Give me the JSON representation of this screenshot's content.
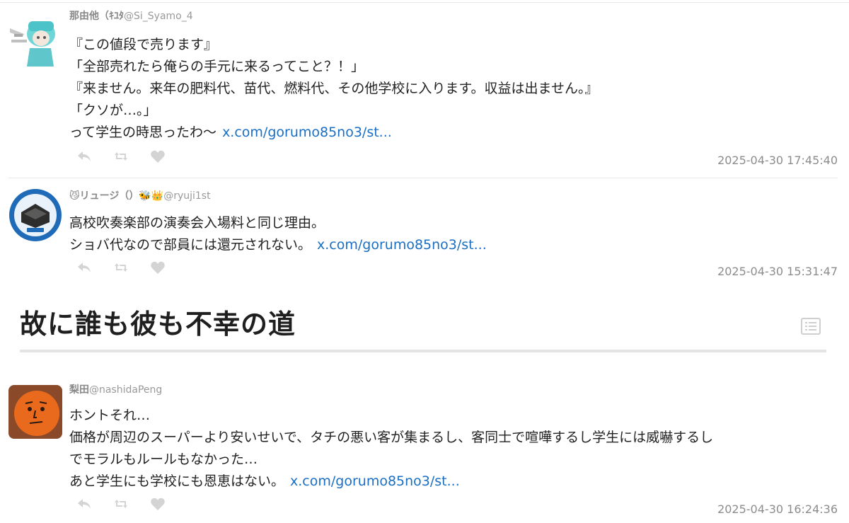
{
  "tweets": [
    {
      "name": "那由他（ｷﾕﾀ",
      "handle": "@Si_Syamo_4",
      "lines": [
        "『この値段で売ります』",
        "「全部売れたら俺らの手元に来るってこと？！」",
        "『来ません。来年の肥料代、苗代、燃料代、その他学校に入ります。収益は出ません。』",
        "「クソが…。」",
        "って学生の時思ったわ〜"
      ],
      "link": "x.com/gorumo85no3/st...",
      "timestamp": "2025-04-30 17:45:40"
    },
    {
      "name": "😼リュージ（）🐝👑",
      "handle": "@ryuji1st",
      "lines": [
        "高校吹奏楽部の演奏会入場料と同じ理由。",
        "ショバ代なので部員には還元されない。"
      ],
      "link": "x.com/gorumo85no3/st...",
      "timestamp": "2025-04-30 15:31:47"
    },
    {
      "name": "梨田",
      "handle": "@nashidaPeng",
      "lines": [
        "ホントそれ…",
        "価格が周辺のスーパーより安いせいで、タチの悪い客が集まるし、客同士で喧嘩するし学生には威嚇するし",
        "でモラルもルールもなかった…",
        "あと学生にも学校にも恩恵はない。"
      ],
      "link": "x.com/gorumo85no3/st...",
      "timestamp": "2025-04-30 16:24:36"
    }
  ],
  "section_heading": "故に誰も彼も不幸の道",
  "icons": {
    "reply": "reply-icon",
    "retweet": "retweet-icon",
    "like": "heart-icon",
    "toc": "list-icon"
  },
  "colors": {
    "link": "#1a6fc4",
    "meta": "#8c8c8c",
    "action_icon": "#d4d4d4"
  }
}
